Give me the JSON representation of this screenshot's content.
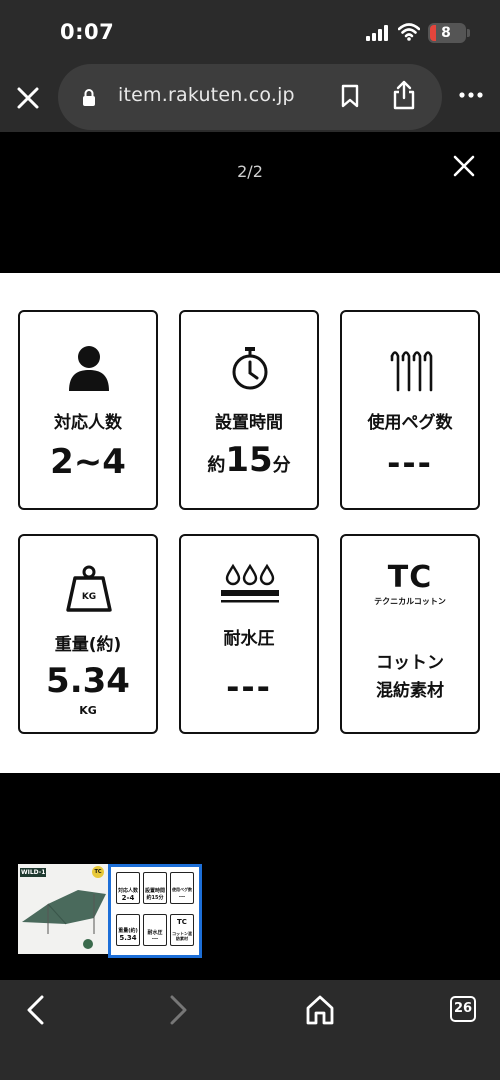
{
  "status_bar": {
    "time": "0:07",
    "battery": "8"
  },
  "browser": {
    "url": "item.rakuten.co.jp"
  },
  "viewer": {
    "page_counter": "2/2"
  },
  "specs": [
    {
      "label": "対応人数",
      "value": "2~4",
      "icon": "person-icon"
    },
    {
      "label": "設置時間",
      "value_prefix": "約",
      "value": "15",
      "value_suffix": "分",
      "icon": "stopwatch-icon"
    },
    {
      "label": "使用ペグ数",
      "value": "---",
      "icon": "pegs-icon"
    },
    {
      "label": "重量(約)",
      "value": "5.34",
      "unit": "KG",
      "icon_text": "KG",
      "icon": "weight-icon"
    },
    {
      "label": "耐水圧",
      "value": "---",
      "icon": "water-drops-icon"
    },
    {
      "title": "TC",
      "subtitle": "テクニカルコットン",
      "label_line1": "コットン",
      "label_line2": "混紡素材",
      "icon": "tc-logo"
    }
  ],
  "thumbnails": {
    "first": {
      "brand": "WILD-1",
      "badge": "TC"
    },
    "second": {
      "cards": [
        {
          "label": "対応人数",
          "value": "2-4"
        },
        {
          "label": "設置時間",
          "value": "約15分"
        },
        {
          "label": "使用ペグ数",
          "value": "---"
        },
        {
          "label": "重量(約)",
          "value": "5.34"
        },
        {
          "label": "耐水圧",
          "value": "---"
        },
        {
          "label": "TC",
          "value": "コットン混紡素材"
        }
      ]
    }
  },
  "toolbar": {
    "tabs_count": "26"
  }
}
